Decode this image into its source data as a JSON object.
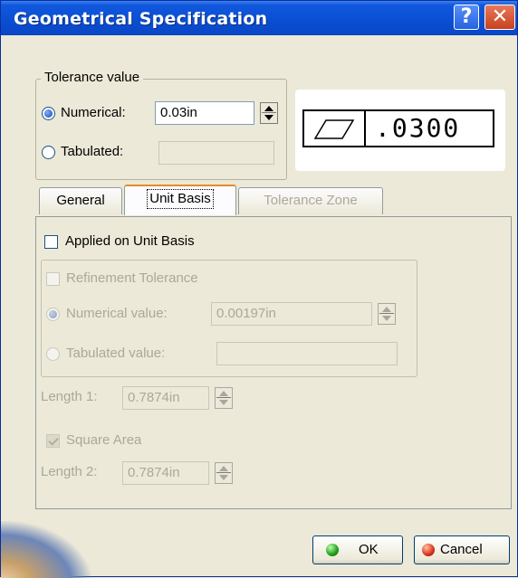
{
  "window": {
    "title": "Geometrical Specification",
    "help_label": "?",
    "close_label": "✕"
  },
  "tolerance_value": {
    "legend": "Tolerance value",
    "numerical_label": "Numerical:",
    "numerical_value": "0.03in",
    "tabulated_label": "Tabulated:",
    "tabulated_value": ""
  },
  "fcf": {
    "symbol": "flatness-icon",
    "value": ".0300"
  },
  "tabs": [
    {
      "label": "General",
      "state": "normal"
    },
    {
      "label": "Unit Basis",
      "state": "active"
    },
    {
      "label": "Tolerance Zone",
      "state": "disabled"
    }
  ],
  "unit_basis": {
    "applied_label": "Applied on Unit Basis",
    "applied_checked": false,
    "refinement": {
      "label": "Refinement Tolerance",
      "numerical_label": "Numerical value:",
      "numerical_value": "0.00197in",
      "tabulated_label": "Tabulated value:",
      "tabulated_value": ""
    },
    "length1_label": "Length 1:",
    "length1_value": "0.7874in",
    "square_area_label": "Square Area",
    "square_area_checked": true,
    "length2_label": "Length 2:",
    "length2_value": "0.7874in"
  },
  "buttons": {
    "ok_label": "OK",
    "cancel_label": "Cancel"
  },
  "colors": {
    "title_bar": "#0a4fd4",
    "dialog_bg": "#ece9d8",
    "tab_highlight": "#e68b2c",
    "ok_dot": "#1f9e16",
    "cancel_dot": "#d9321a"
  }
}
